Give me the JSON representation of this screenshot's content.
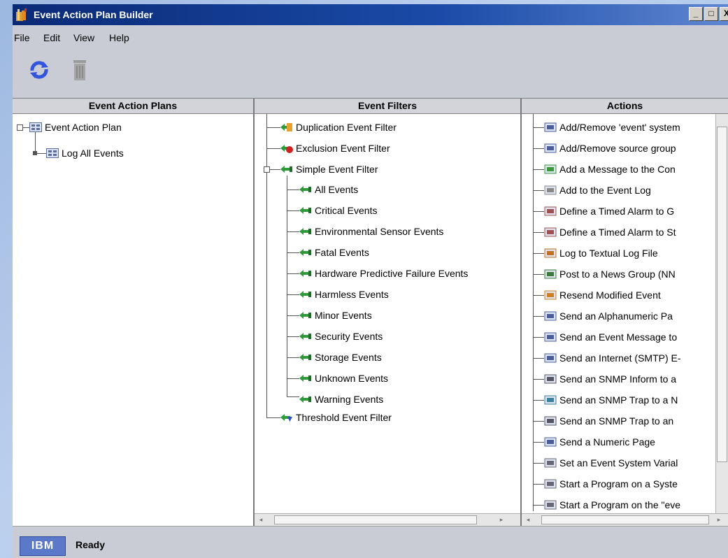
{
  "window": {
    "title": "Event Action Plan Builder",
    "buttons": [
      "_",
      "□",
      "X"
    ]
  },
  "menu": {
    "items": [
      "File",
      "Edit",
      "View",
      "Help"
    ]
  },
  "toolbar": {
    "icons": [
      "refresh-icon",
      "trash-icon"
    ]
  },
  "panes": {
    "plans": {
      "header": "Event Action Plans",
      "root": "Event Action Plan",
      "children": [
        "Log All Events"
      ]
    },
    "filters": {
      "header": "Event Filters",
      "items": [
        {
          "label": "Duplication Event Filter",
          "icon": "duplication-filter-icon"
        },
        {
          "label": "Exclusion Event Filter",
          "icon": "exclusion-filter-icon"
        },
        {
          "label": "Simple Event Filter",
          "icon": "simple-filter-icon"
        },
        {
          "label": "Threshold Event Filter",
          "icon": "threshold-filter-icon"
        }
      ],
      "simple_children": [
        "All Events",
        "Critical Events",
        "Environmental Sensor Events",
        "Fatal Events",
        "Hardware Predictive Failure Events",
        "Harmless Events",
        "Minor Events",
        "Security Events",
        "Storage Events",
        "Unknown Events",
        "Warning Events"
      ]
    },
    "actions": {
      "header": "Actions",
      "items": [
        "Add/Remove 'event' system",
        "Add/Remove source group",
        "Add a Message to the Con",
        "Add to the Event Log",
        "Define a Timed Alarm to G",
        "Define a Timed Alarm to St",
        "Log to Textual Log File",
        "Post to a News Group (NN",
        "Resend Modified Event",
        "Send an Alphanumeric Pa",
        "Send an Event Message to",
        "Send an Internet (SMTP) E-",
        "Send an SNMP Inform to a",
        "Send an SNMP Trap to a N",
        "Send an SNMP Trap to an",
        "Send a Numeric Page",
        "Set an Event System Varial",
        "Start a Program on a Syste",
        "Start a Program on the \"eve"
      ]
    }
  },
  "status": {
    "logo": "IBM",
    "text": "Ready"
  },
  "colors": {
    "title_bar": "#0b2a76",
    "window_bg": "#c9ccd4",
    "filter_icon": "#2e9b3a",
    "ibm_logo": "#5a79c8"
  }
}
